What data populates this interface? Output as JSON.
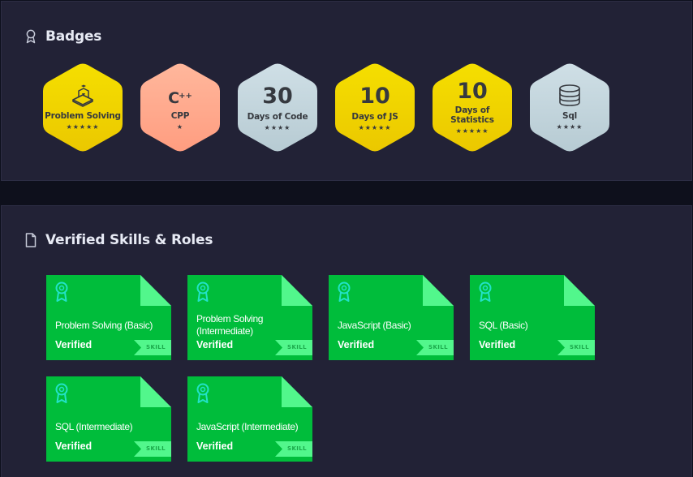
{
  "badges_section": {
    "title": "Badges",
    "title_icon": "award-ribbon-icon",
    "badges": [
      {
        "name": "Problem Solving",
        "icon": "problem-solving-icon",
        "number": "",
        "stars": "★★★★★",
        "color": "#f2d600"
      },
      {
        "name": "CPP",
        "icon": "cpp-icon",
        "number": "",
        "stars": "★",
        "color": "#ffad91"
      },
      {
        "name": "Days of Code",
        "icon": "",
        "number": "30",
        "stars": "★★★★",
        "color": "#c4d6de"
      },
      {
        "name": "Days of JS",
        "icon": "",
        "number": "10",
        "stars": "★★★★★",
        "color": "#f2d600"
      },
      {
        "name": "Days of Statistics",
        "name_line1": "Days of",
        "name_line2": "Statistics",
        "icon": "",
        "number": "10",
        "stars": "★★★★★",
        "color": "#f2d600"
      },
      {
        "name": "Sql",
        "icon": "database-icon",
        "number": "",
        "stars": "★★★★",
        "color": "#c4d6de"
      }
    ]
  },
  "skills_section": {
    "title": "Verified Skills & Roles",
    "title_icon": "document-icon",
    "cards": [
      {
        "title": "Problem Solving (Basic)",
        "status": "Verified",
        "tag": "SKILL"
      },
      {
        "title": "Problem Solving (Intermediate)",
        "status": "Verified",
        "tag": "SKILL"
      },
      {
        "title": "JavaScript (Basic)",
        "status": "Verified",
        "tag": "SKILL"
      },
      {
        "title": "SQL (Basic)",
        "status": "Verified",
        "tag": "SKILL"
      },
      {
        "title": "SQL (Intermediate)",
        "status": "Verified",
        "tag": "SKILL"
      },
      {
        "title": "JavaScript (Intermediate)",
        "status": "Verified",
        "tag": "SKILL"
      }
    ],
    "card_colors": {
      "body": "#00bd3b",
      "fold": "#52f78c",
      "ribbon": "#22e2c8"
    }
  },
  "cpp_label": {
    "main": "C",
    "sup": "++"
  }
}
